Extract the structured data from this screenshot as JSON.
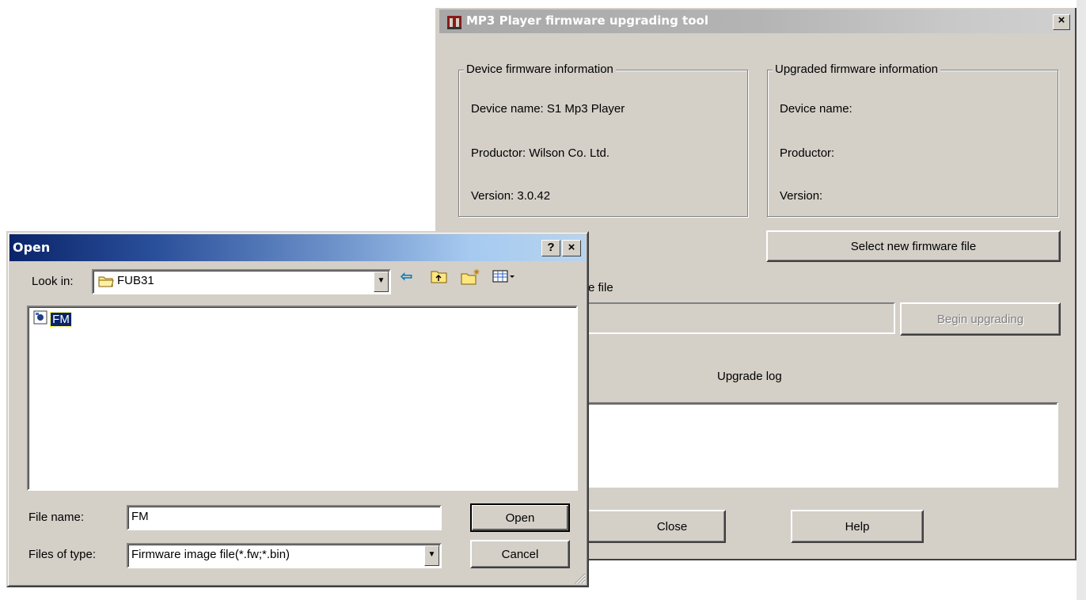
{
  "mp3_window": {
    "title": "MP3 Player firmware upgrading tool",
    "close_glyph": "×",
    "device_group": {
      "legend": "Device firmware information",
      "device_name": "Device name: S1 Mp3 Player",
      "productor": "Productor: Wilson Co. Ltd.",
      "version": "Version: 3.0.42"
    },
    "upgraded_group": {
      "legend": "Upgraded firmware information",
      "device_name": "Device name:",
      "productor": "Productor:",
      "version": "Version:"
    },
    "select_button": "Select new firmware file",
    "file_label_partial": "e file",
    "begin_button": "Begin upgrading",
    "log_label": "Upgrade log",
    "close_button": "Close",
    "help_button": "Help"
  },
  "open_dialog": {
    "title": "Open",
    "help_glyph": "?",
    "close_glyph": "×",
    "look_in_label": "Look in:",
    "look_in_value": "FUB31",
    "files": [
      {
        "name": "FM",
        "icon": "firmware-file-icon"
      }
    ],
    "file_name_label": "File name:",
    "file_name_value": "FM",
    "files_of_type_label": "Files of type:",
    "files_of_type_value": "Firmware image file(*.fw;*.bin)",
    "open_button": "Open",
    "cancel_button": "Cancel",
    "toolbar_icons": [
      "back-arrow-icon",
      "up-folder-icon",
      "new-folder-icon",
      "view-menu-icon"
    ]
  },
  "colors": {
    "face": "#d4d0c8",
    "active_title_start": "#0a246a",
    "active_title_end": "#a6caf0",
    "inactive_title": "#b4b4b4"
  }
}
